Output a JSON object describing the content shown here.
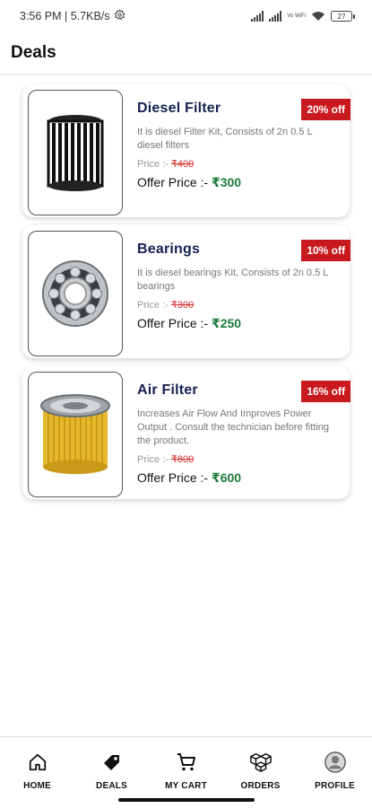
{
  "status_bar": {
    "time_speed": "3:56 PM | 5.7KB/s",
    "network_label": "Vo WiFi",
    "battery": "27"
  },
  "header": {
    "title": "Deals"
  },
  "deals": [
    {
      "name": "Diesel Filter",
      "description": "It is diesel Filter Kit, Consists of 2n 0.5 L diesel filters",
      "price_label": "Price :-",
      "price": "₹400",
      "offer_label": "Offer Price :-",
      "offer_price": "₹300",
      "discount": "20% off",
      "image_icon": "diesel-filter-image"
    },
    {
      "name": "Bearings",
      "description": "It is diesel bearings Kit, Consists of 2n 0.5 L  bearings",
      "price_label": "Price :-",
      "price": "₹300",
      "offer_label": "Offer Price :-",
      "offer_price": "₹250",
      "discount": "10% off",
      "image_icon": "bearing-image"
    },
    {
      "name": "Air Filter",
      "description": "Increases Air Flow And Improves Power Output . Consult the technician before fitting the product.",
      "price_label": "Price :-",
      "price": "₹800",
      "offer_label": "Offer Price :-",
      "offer_price": "₹600",
      "discount": "16% off",
      "image_icon": "air-filter-image"
    }
  ],
  "bottom_nav": [
    {
      "label": "HOME",
      "icon": "home-icon"
    },
    {
      "label": "DEALS",
      "icon": "tag-icon"
    },
    {
      "label": "MY CART",
      "icon": "cart-icon"
    },
    {
      "label": "ORDERS",
      "icon": "boxes-icon"
    },
    {
      "label": "PROFILE",
      "icon": "profile-icon"
    }
  ],
  "colors": {
    "title_navy": "#16214f",
    "offer_green": "#1b7a3a",
    "strike_red": "#d32f2f",
    "badge_red": "#c8191e"
  }
}
